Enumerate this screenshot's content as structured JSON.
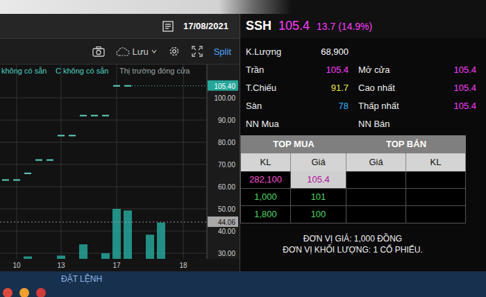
{
  "header": {
    "date": "17/08/2021"
  },
  "toolbar": {
    "save_label": "Lưu",
    "split_label": "Split"
  },
  "chart": {
    "legend": [
      {
        "label": "không có sẵn"
      },
      {
        "label": "C không có sẵn"
      },
      {
        "label": "Thị trường đóng cửa"
      }
    ],
    "y_ticks": [
      "100.00",
      "90.00",
      "80.00",
      "70.00",
      "60.00",
      "50.00",
      "40.00",
      "30.00"
    ],
    "x_ticks": [
      "10",
      "13",
      "17",
      "18"
    ],
    "last_price_tag": "105.40",
    "ref_price_tag": "44.06",
    "prices": [
      63,
      63,
      66,
      72,
      72,
      83,
      83,
      92,
      92,
      92,
      105.4,
      105.4,
      null,
      null,
      null
    ],
    "volumes": [
      0,
      0,
      3,
      0,
      0,
      4,
      0,
      18,
      0,
      7,
      62,
      60,
      0,
      30,
      45
    ]
  },
  "quote": {
    "symbol": "SSH",
    "price": "105.4",
    "change": "13.7 (14.9%)"
  },
  "volume": {
    "label": "K.Lượng",
    "value": "68,900"
  },
  "stats_left": [
    {
      "label": "Trần",
      "value": "105.4",
      "color": "#ff3dff"
    },
    {
      "label": "T.Chiếu",
      "value": "91.7",
      "color": "#f2e84b"
    },
    {
      "label": "Sàn",
      "value": "78",
      "color": "#2fb6ff"
    },
    {
      "label": "NN Mua",
      "value": "",
      "color": "#ffffff"
    }
  ],
  "stats_right": [
    {
      "label": "Mở cửa",
      "value": "105.4",
      "color": "#ff3dff"
    },
    {
      "label": "Cao nhất",
      "value": "105.4",
      "color": "#ff3dff"
    },
    {
      "label": "Thấp nhất",
      "value": "105.4",
      "color": "#ff3dff"
    },
    {
      "label": "NN Bán",
      "value": "",
      "color": "#ffffff"
    }
  ],
  "order_book": {
    "buy_title": "TOP MUA",
    "sell_title": "TOP BÁN",
    "columns": [
      "KL",
      "Giá",
      "Giá",
      "KL"
    ],
    "rows": [
      {
        "buy_volume": "282,100",
        "buy_price": "105.4",
        "sell_price": "",
        "sell_volume": "",
        "color": "#ff4fd8",
        "highlighted": true
      },
      {
        "buy_volume": "1,000",
        "buy_price": "101",
        "sell_price": "",
        "sell_volume": "",
        "color": "#4cd964",
        "highlighted": false
      },
      {
        "buy_volume": "1,800",
        "buy_price": "100",
        "sell_price": "",
        "sell_volume": "",
        "color": "#4cd964",
        "highlighted": false
      }
    ]
  },
  "notes": [
    "ĐƠN VỊ GIÁ: 1,000 ĐỒNG",
    "ĐƠN VỊ KHỐI LƯỢNG: 1 CỔ PHIẾU."
  ],
  "bottom": {
    "order_label": "ĐẶT LỆNH"
  }
}
